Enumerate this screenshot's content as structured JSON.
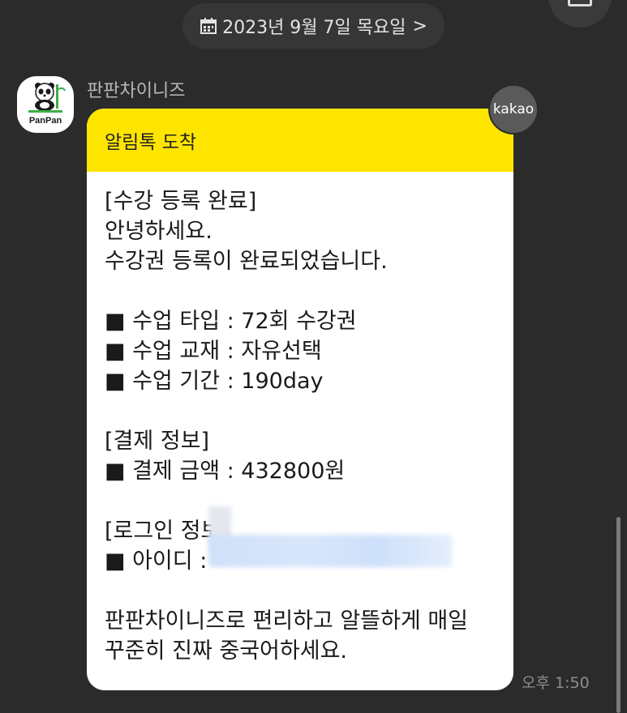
{
  "date_header": {
    "label": "2023년 9월 7일 목요일",
    "chevron": ">",
    "icon": "calendar-icon"
  },
  "sender": {
    "name": "판판차이니즈",
    "avatar_text": "PanPan"
  },
  "badge": {
    "label": "kakao"
  },
  "card": {
    "header": "알림톡 도착",
    "lines": [
      "[수강 등록 완료]",
      "안녕하세요.",
      "수강권 등록이 완료되었습니다.",
      "",
      "■ 수업 타입 : 72회 수강권",
      "■ 수업 교재 : 자유선택",
      "■ 수업 기간 : 190day",
      "",
      "[결제 정보]",
      "■ 결제 금액 : 432800원",
      "",
      "[로그인 정보]",
      "■ 아이디 : ",
      "",
      "판판차이니즈로 편리하고 알뜰하게 매일",
      "꾸준히 진짜 중국어하세요."
    ]
  },
  "timestamp": "오후 1:50",
  "colors": {
    "header_yellow": "#fee500",
    "background": "#2b2b2b",
    "card": "#ffffff"
  }
}
